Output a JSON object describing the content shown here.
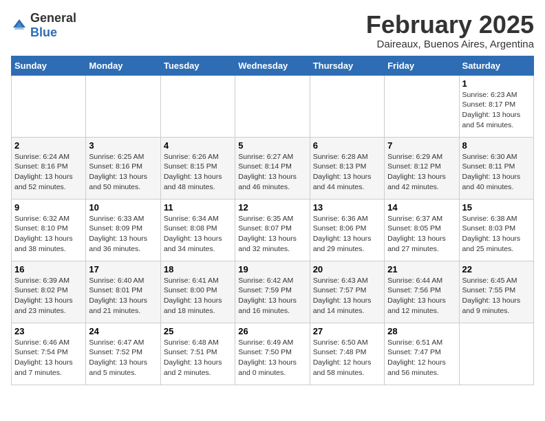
{
  "header": {
    "logo_general": "General",
    "logo_blue": "Blue",
    "month_title": "February 2025",
    "subtitle": "Daireaux, Buenos Aires, Argentina"
  },
  "days_of_week": [
    "Sunday",
    "Monday",
    "Tuesday",
    "Wednesday",
    "Thursday",
    "Friday",
    "Saturday"
  ],
  "weeks": [
    [
      {
        "day": "",
        "content": ""
      },
      {
        "day": "",
        "content": ""
      },
      {
        "day": "",
        "content": ""
      },
      {
        "day": "",
        "content": ""
      },
      {
        "day": "",
        "content": ""
      },
      {
        "day": "",
        "content": ""
      },
      {
        "day": "1",
        "content": "Sunrise: 6:23 AM\nSunset: 8:17 PM\nDaylight: 13 hours\nand 54 minutes."
      }
    ],
    [
      {
        "day": "2",
        "content": "Sunrise: 6:24 AM\nSunset: 8:16 PM\nDaylight: 13 hours\nand 52 minutes."
      },
      {
        "day": "3",
        "content": "Sunrise: 6:25 AM\nSunset: 8:16 PM\nDaylight: 13 hours\nand 50 minutes."
      },
      {
        "day": "4",
        "content": "Sunrise: 6:26 AM\nSunset: 8:15 PM\nDaylight: 13 hours\nand 48 minutes."
      },
      {
        "day": "5",
        "content": "Sunrise: 6:27 AM\nSunset: 8:14 PM\nDaylight: 13 hours\nand 46 minutes."
      },
      {
        "day": "6",
        "content": "Sunrise: 6:28 AM\nSunset: 8:13 PM\nDaylight: 13 hours\nand 44 minutes."
      },
      {
        "day": "7",
        "content": "Sunrise: 6:29 AM\nSunset: 8:12 PM\nDaylight: 13 hours\nand 42 minutes."
      },
      {
        "day": "8",
        "content": "Sunrise: 6:30 AM\nSunset: 8:11 PM\nDaylight: 13 hours\nand 40 minutes."
      }
    ],
    [
      {
        "day": "9",
        "content": "Sunrise: 6:32 AM\nSunset: 8:10 PM\nDaylight: 13 hours\nand 38 minutes."
      },
      {
        "day": "10",
        "content": "Sunrise: 6:33 AM\nSunset: 8:09 PM\nDaylight: 13 hours\nand 36 minutes."
      },
      {
        "day": "11",
        "content": "Sunrise: 6:34 AM\nSunset: 8:08 PM\nDaylight: 13 hours\nand 34 minutes."
      },
      {
        "day": "12",
        "content": "Sunrise: 6:35 AM\nSunset: 8:07 PM\nDaylight: 13 hours\nand 32 minutes."
      },
      {
        "day": "13",
        "content": "Sunrise: 6:36 AM\nSunset: 8:06 PM\nDaylight: 13 hours\nand 29 minutes."
      },
      {
        "day": "14",
        "content": "Sunrise: 6:37 AM\nSunset: 8:05 PM\nDaylight: 13 hours\nand 27 minutes."
      },
      {
        "day": "15",
        "content": "Sunrise: 6:38 AM\nSunset: 8:03 PM\nDaylight: 13 hours\nand 25 minutes."
      }
    ],
    [
      {
        "day": "16",
        "content": "Sunrise: 6:39 AM\nSunset: 8:02 PM\nDaylight: 13 hours\nand 23 minutes."
      },
      {
        "day": "17",
        "content": "Sunrise: 6:40 AM\nSunset: 8:01 PM\nDaylight: 13 hours\nand 21 minutes."
      },
      {
        "day": "18",
        "content": "Sunrise: 6:41 AM\nSunset: 8:00 PM\nDaylight: 13 hours\nand 18 minutes."
      },
      {
        "day": "19",
        "content": "Sunrise: 6:42 AM\nSunset: 7:59 PM\nDaylight: 13 hours\nand 16 minutes."
      },
      {
        "day": "20",
        "content": "Sunrise: 6:43 AM\nSunset: 7:57 PM\nDaylight: 13 hours\nand 14 minutes."
      },
      {
        "day": "21",
        "content": "Sunrise: 6:44 AM\nSunset: 7:56 PM\nDaylight: 13 hours\nand 12 minutes."
      },
      {
        "day": "22",
        "content": "Sunrise: 6:45 AM\nSunset: 7:55 PM\nDaylight: 13 hours\nand 9 minutes."
      }
    ],
    [
      {
        "day": "23",
        "content": "Sunrise: 6:46 AM\nSunset: 7:54 PM\nDaylight: 13 hours\nand 7 minutes."
      },
      {
        "day": "24",
        "content": "Sunrise: 6:47 AM\nSunset: 7:52 PM\nDaylight: 13 hours\nand 5 minutes."
      },
      {
        "day": "25",
        "content": "Sunrise: 6:48 AM\nSunset: 7:51 PM\nDaylight: 13 hours\nand 2 minutes."
      },
      {
        "day": "26",
        "content": "Sunrise: 6:49 AM\nSunset: 7:50 PM\nDaylight: 13 hours\nand 0 minutes."
      },
      {
        "day": "27",
        "content": "Sunrise: 6:50 AM\nSunset: 7:48 PM\nDaylight: 12 hours\nand 58 minutes."
      },
      {
        "day": "28",
        "content": "Sunrise: 6:51 AM\nSunset: 7:47 PM\nDaylight: 12 hours\nand 56 minutes."
      },
      {
        "day": "",
        "content": ""
      }
    ]
  ]
}
